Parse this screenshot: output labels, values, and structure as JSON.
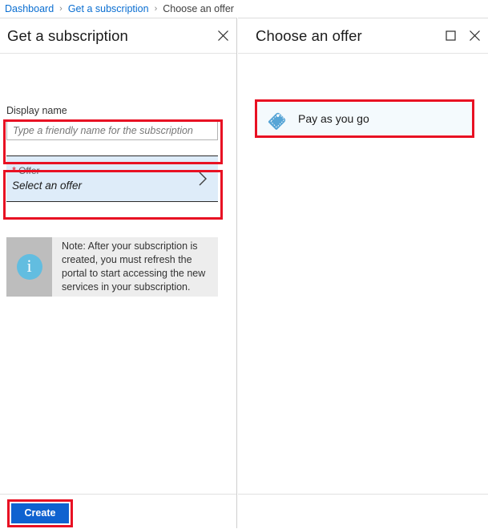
{
  "breadcrumb": {
    "items": [
      {
        "label": "Dashboard",
        "current": false
      },
      {
        "label": "Get a subscription",
        "current": false
      },
      {
        "label": "Choose an offer",
        "current": true
      }
    ],
    "separator": "›"
  },
  "left_panel": {
    "title": "Get a subscription",
    "close_label": "close-icon",
    "display_name": {
      "label": "Display name",
      "value": "",
      "placeholder": "Type a friendly name for the subscription"
    },
    "offer": {
      "required_marker": "*",
      "label": "Offer",
      "value": "Select an offer",
      "chevron": "chevron-right-icon"
    },
    "note": {
      "icon": "info-icon",
      "icon_glyph": "i",
      "text": "Note: After your subscription is created, you must refresh the portal to start accessing the new services in your subscription."
    },
    "create_button": "Create"
  },
  "right_panel": {
    "title": "Choose an offer",
    "maximize_label": "maximize-icon",
    "close_label": "close-icon",
    "offers": [
      {
        "label": "Pay as you go",
        "icon": "price-tag-icon"
      }
    ]
  },
  "colors": {
    "breadcrumb_link": "#0a6ed1",
    "annotation_red": "#e81123",
    "create_blue": "#0f62d0",
    "offer_field_blue": "#deecf9",
    "offer_item_blue": "#f4fafd",
    "tag_icon_blue": "#4a9fd4",
    "info_icon_blue": "#62bde0",
    "note_icon_bg": "#bdbdbd",
    "note_text_bg": "#ededed"
  }
}
